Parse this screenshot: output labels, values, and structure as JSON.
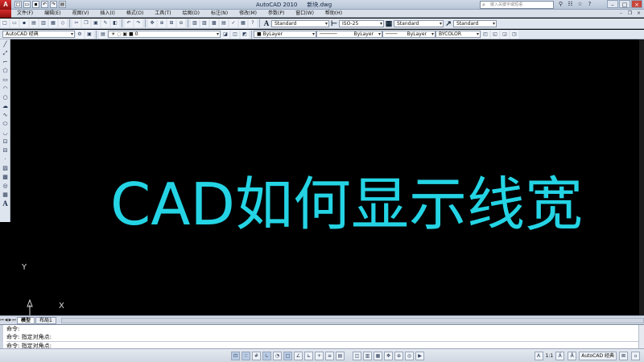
{
  "window": {
    "app_title": "AutoCAD 2010",
    "doc_title": "新块.dwg",
    "search_placeholder": "键入关键字或短语"
  },
  "menu": {
    "items": [
      "文件(F)",
      "编辑(E)",
      "视图(V)",
      "插入(I)",
      "格式(O)",
      "工具(T)",
      "绘图(D)",
      "标注(N)",
      "修改(M)",
      "参数(P)",
      "窗口(W)",
      "帮助(H)"
    ]
  },
  "toolbar1": {
    "text_style": "Standard",
    "dim_style": "ISO-25",
    "table_style": "Standard",
    "mleader_style": "Standard"
  },
  "toolbar2": {
    "workspace": "AutoCAD 经典",
    "layer": "0",
    "color": "ByLayer",
    "linetype": "ByLayer",
    "lineweight": "ByLayer",
    "plot_style": "BYCOLOR"
  },
  "canvas": {
    "headline": "CAD如何显示线宽",
    "axis_x": "X",
    "axis_y": "Y",
    "text_color": "#24d4e4",
    "background": "#000000"
  },
  "tabs": {
    "model": "模型",
    "layout": "布局1"
  },
  "command": {
    "lines": [
      "命令:",
      "命令: 指定对角点:"
    ],
    "prompt": "命令: 指定对角点:"
  },
  "status": {
    "workspace_label": "AutoCAD 经典",
    "scale": "1:1"
  }
}
